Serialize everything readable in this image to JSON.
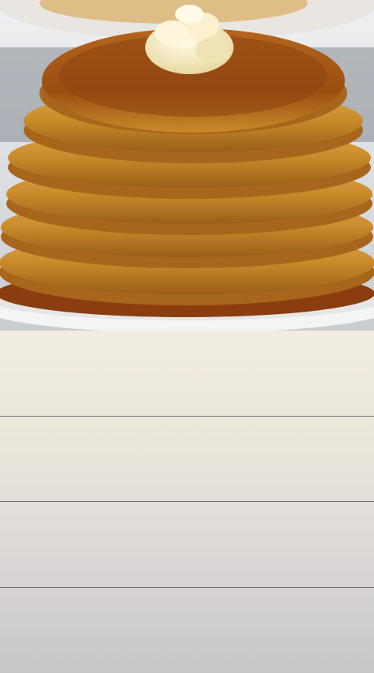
{
  "hero": {
    "subject": "pancake-stack-photo"
  },
  "list": {
    "row_count": 4
  },
  "colors": {
    "row_top": "#f2ede0",
    "row_bottom": "#c9c6c9",
    "divider": "#6f6a66",
    "pancake": "#c98a2a",
    "syrup": "#8a3e10",
    "butter": "#f6edc8",
    "plate": "#f4f4f4"
  }
}
